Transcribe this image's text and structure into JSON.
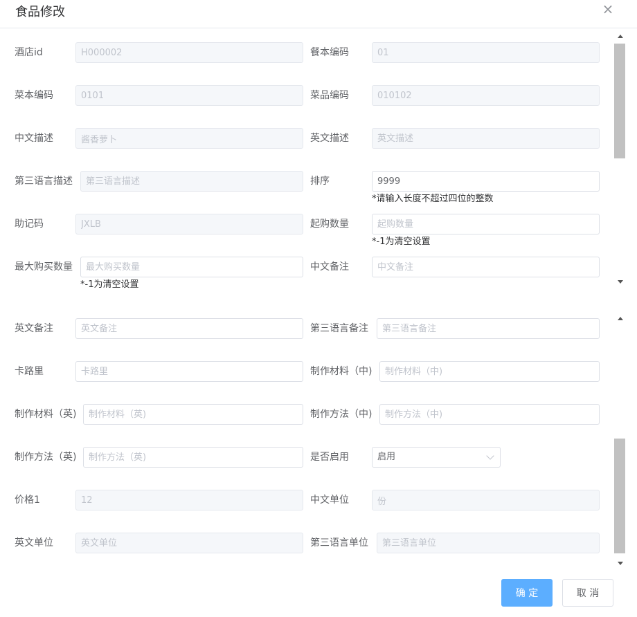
{
  "dialog": {
    "title": "食品修改",
    "close_glyph": "×"
  },
  "form": {
    "hotel_id": {
      "label": "酒店id",
      "value": "H000002"
    },
    "menu_book_code": {
      "label": "餐本编码",
      "value": "01"
    },
    "menu_code": {
      "label": "菜本编码",
      "value": "0101"
    },
    "dish_code": {
      "label": "菜品编码",
      "value": "010102"
    },
    "desc_cn": {
      "label": "中文描述",
      "value": "酱香萝卜"
    },
    "desc_en": {
      "label": "英文描述",
      "placeholder": "英文描述"
    },
    "desc_third": {
      "label": "第三语言描述",
      "placeholder": "第三语言描述"
    },
    "sort": {
      "label": "排序",
      "value": "9999",
      "hint": "*请输入长度不超过四位的整数"
    },
    "mnemonic": {
      "label": "助记码",
      "value": "JXLB"
    },
    "min_qty": {
      "label": "起购数量",
      "placeholder": "起购数量",
      "hint": "*-1为清空设置"
    },
    "max_qty": {
      "label": "最大购买数量",
      "placeholder": "最大购买数量",
      "hint": "*-1为清空设置"
    },
    "note_cn": {
      "label": "中文备注",
      "placeholder": "中文备注"
    },
    "note_en": {
      "label": "英文备注",
      "placeholder": "英文备注"
    },
    "note_third": {
      "label": "第三语言备注",
      "placeholder": "第三语言备注"
    },
    "calories": {
      "label": "卡路里",
      "placeholder": "卡路里"
    },
    "material_cn": {
      "label": "制作材料（中)",
      "placeholder": "制作材料（中)"
    },
    "material_en": {
      "label": "制作材料（英)",
      "placeholder": "制作材料（英)"
    },
    "method_cn": {
      "label": "制作方法（中)",
      "placeholder": "制作方法（中)"
    },
    "method_en": {
      "label": "制作方法（英)",
      "placeholder": "制作方法（英)"
    },
    "enabled": {
      "label": "是否启用",
      "value": "启用"
    },
    "price1": {
      "label": "价格1",
      "value": "12"
    },
    "unit_cn": {
      "label": "中文单位",
      "value": "份"
    },
    "unit_en": {
      "label": "英文单位",
      "placeholder": "英文单位"
    },
    "unit_third": {
      "label": "第三语言单位",
      "placeholder": "第三语言单位"
    }
  },
  "footer": {
    "confirm_label": "确 定",
    "cancel_label": "取 消"
  },
  "colors": {
    "primary": "#5caeff",
    "border": "#dcdfe6",
    "disabled_bg": "#f5f7fa",
    "text": "#606266"
  }
}
